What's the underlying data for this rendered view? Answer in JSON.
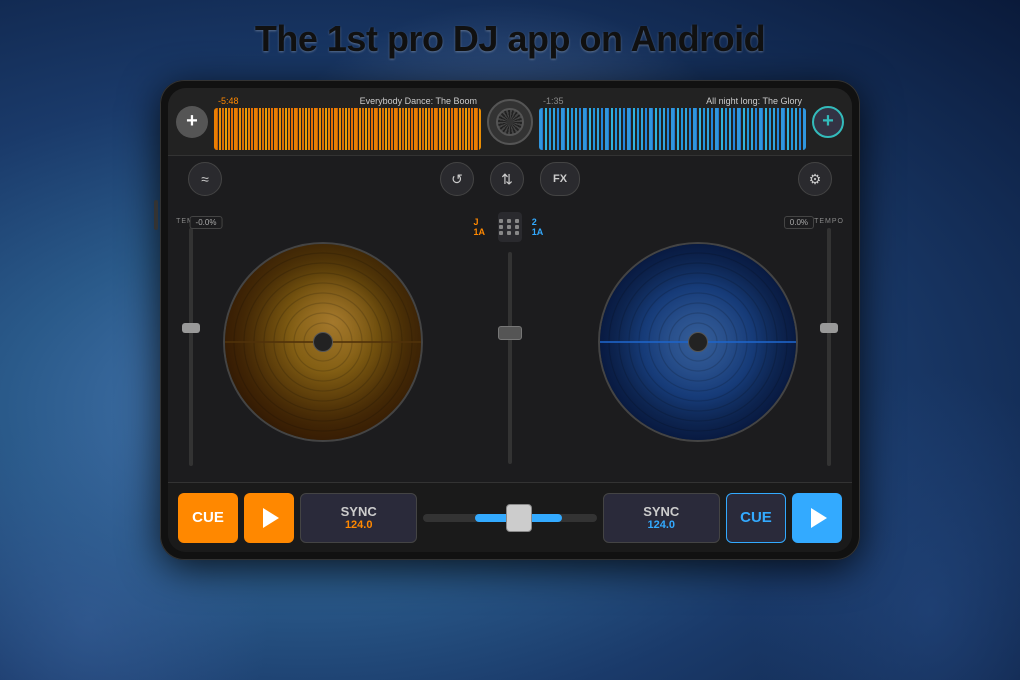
{
  "headline": "The 1st pro DJ app on Android",
  "app": {
    "track_left": {
      "time": "-5:48",
      "name": "Everybody Dance: The Boom"
    },
    "track_right": {
      "time": "-1:35",
      "name": "All night long: The Glory"
    },
    "deck_left_label": "J 1A",
    "deck_right_label": "2 1A",
    "bottom": {
      "cue_left": "CUE",
      "cue_right": "CUE",
      "sync_left_label": "SYNC",
      "sync_left_bpm": "124.0",
      "sync_right_label": "SYNC",
      "sync_right_bpm": "124.0",
      "tempo_left": "TEMPO",
      "tempo_right": "TEMPO",
      "pitch_left": "-0.0%",
      "pitch_right": "0.0%"
    },
    "controls": {
      "wave_icon": "≈",
      "loop_icon": "↺",
      "eq_icon": "⇅",
      "fx_label": "FX",
      "gear_icon": "⚙"
    }
  }
}
